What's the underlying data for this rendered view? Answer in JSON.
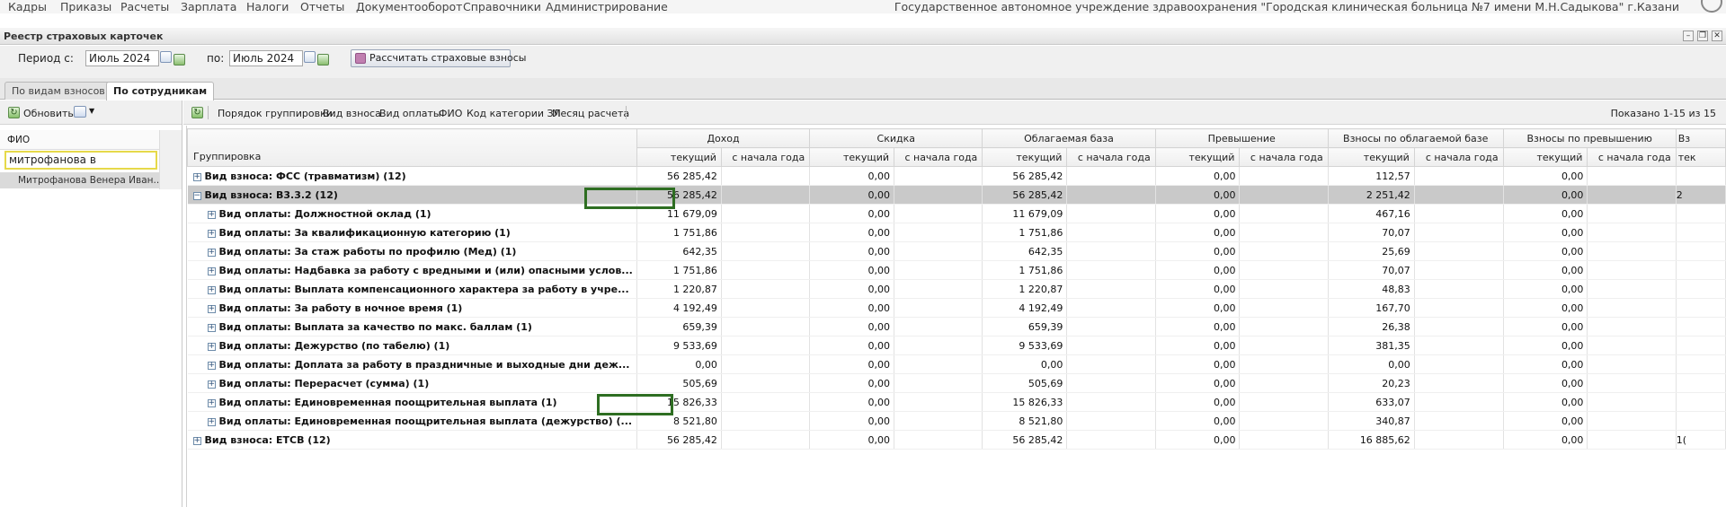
{
  "menu": {
    "items": [
      "Кадры",
      "Приказы",
      "Расчеты",
      "Зарплата",
      "Налоги",
      "Отчеты",
      "Документооборот",
      "Справочники",
      "Администрирование"
    ],
    "organization": "Государственное автономное учреждение здравоохранения \"Городская клиническая больница №7 имени М.Н.Садыкова\" г.Казани"
  },
  "panel": {
    "title": "Реестр страховых карточек",
    "window_buttons": [
      "–",
      "❐",
      "✕"
    ]
  },
  "period": {
    "from_label": "Период с:",
    "from_value": "Июль 2024",
    "to_label": "по:",
    "to_value": "Июль 2024",
    "calc_button": "Рассчитать страховые взносы"
  },
  "tabs": [
    {
      "label": "По видам взносов",
      "active": false
    },
    {
      "label": "По сотрудникам",
      "active": true
    }
  ],
  "left": {
    "refresh": "Обновить",
    "fio_header": "ФИО",
    "search_value": "митрофанова в",
    "result": "Митрофанова Венера Иван..."
  },
  "toolbar": {
    "grouping_label": "Порядок группировки:",
    "grouping_items": [
      "Вид взноса",
      "Вид оплаты",
      "ФИО",
      "Код категории ЗЛ",
      "Месяц расчета"
    ],
    "shown": "Показано 1-15 из 15"
  },
  "grid": {
    "group_header": "Группировка",
    "column_groups": [
      "Доход",
      "Скидка",
      "Облагаемая база",
      "Превышение",
      "Взносы по облагаемой базе",
      "Взносы по превышению",
      "Вз"
    ],
    "sub_current": "текущий",
    "sub_ytd": "с начала года",
    "sub_cut": "тек",
    "rows": [
      {
        "label": "Вид взноса: ФСС (травматизм) (12)",
        "level": 0,
        "values": [
          "56 285,42",
          "",
          "0,00",
          "",
          "56 285,42",
          "",
          "0,00",
          "",
          "112,57",
          "",
          "0,00",
          "",
          ""
        ]
      },
      {
        "label": "Вид взноса: В3.3.2 (12)",
        "level": 0,
        "expanded": true,
        "selected": true,
        "values": [
          "56 285,42",
          "",
          "0,00",
          "",
          "56 285,42",
          "",
          "0,00",
          "",
          "2 251,42",
          "",
          "0,00",
          "",
          "2"
        ]
      },
      {
        "label": "Вид оплаты: Должностной оклад (1)",
        "level": 1,
        "values": [
          "11 679,09",
          "",
          "0,00",
          "",
          "11 679,09",
          "",
          "0,00",
          "",
          "467,16",
          "",
          "0,00",
          "",
          ""
        ]
      },
      {
        "label": "Вид оплаты: За квалификационную категорию (1)",
        "level": 1,
        "values": [
          "1 751,86",
          "",
          "0,00",
          "",
          "1 751,86",
          "",
          "0,00",
          "",
          "70,07",
          "",
          "0,00",
          "",
          ""
        ]
      },
      {
        "label": "Вид оплаты: За стаж работы по профилю (Мед) (1)",
        "level": 1,
        "values": [
          "642,35",
          "",
          "0,00",
          "",
          "642,35",
          "",
          "0,00",
          "",
          "25,69",
          "",
          "0,00",
          "",
          ""
        ]
      },
      {
        "label": "Вид оплаты: Надбавка за работу с вредными и (или) опасными услов...",
        "level": 1,
        "values": [
          "1 751,86",
          "",
          "0,00",
          "",
          "1 751,86",
          "",
          "0,00",
          "",
          "70,07",
          "",
          "0,00",
          "",
          ""
        ]
      },
      {
        "label": "Вид оплаты: Выплата компенсационного характера за работу в учре...",
        "level": 1,
        "values": [
          "1 220,87",
          "",
          "0,00",
          "",
          "1 220,87",
          "",
          "0,00",
          "",
          "48,83",
          "",
          "0,00",
          "",
          ""
        ]
      },
      {
        "label": "Вид оплаты: За работу в ночное время (1)",
        "level": 1,
        "values": [
          "4 192,49",
          "",
          "0,00",
          "",
          "4 192,49",
          "",
          "0,00",
          "",
          "167,70",
          "",
          "0,00",
          "",
          ""
        ]
      },
      {
        "label": "Вид оплаты: Выплата за качество по макс. баллам (1)",
        "level": 1,
        "values": [
          "659,39",
          "",
          "0,00",
          "",
          "659,39",
          "",
          "0,00",
          "",
          "26,38",
          "",
          "0,00",
          "",
          ""
        ]
      },
      {
        "label": "Вид оплаты: Дежурство (по табелю) (1)",
        "level": 1,
        "values": [
          "9 533,69",
          "",
          "0,00",
          "",
          "9 533,69",
          "",
          "0,00",
          "",
          "381,35",
          "",
          "0,00",
          "",
          ""
        ]
      },
      {
        "label": "Вид оплаты: Доплата за работу в праздничные и выходные дни деж...",
        "level": 1,
        "values": [
          "0,00",
          "",
          "0,00",
          "",
          "0,00",
          "",
          "0,00",
          "",
          "0,00",
          "",
          "0,00",
          "",
          ""
        ]
      },
      {
        "label": "Вид оплаты: Перерасчет (сумма) (1)",
        "level": 1,
        "values": [
          "505,69",
          "",
          "0,00",
          "",
          "505,69",
          "",
          "0,00",
          "",
          "20,23",
          "",
          "0,00",
          "",
          ""
        ]
      },
      {
        "label": "Вид оплаты: Единовременная поощрительная выплата (1)",
        "level": 1,
        "values": [
          "15 826,33",
          "",
          "0,00",
          "",
          "15 826,33",
          "",
          "0,00",
          "",
          "633,07",
          "",
          "0,00",
          "",
          ""
        ]
      },
      {
        "label": "Вид оплаты: Единовременная поощрительная выплата (дежурство) (...",
        "level": 1,
        "values": [
          "8 521,80",
          "",
          "0,00",
          "",
          "8 521,80",
          "",
          "0,00",
          "",
          "340,87",
          "",
          "0,00",
          "",
          ""
        ]
      },
      {
        "label": "Вид взноса: ЕТСВ (12)",
        "level": 0,
        "values": [
          "56 285,42",
          "",
          "0,00",
          "",
          "56 285,42",
          "",
          "0,00",
          "",
          "16 885,62",
          "",
          "0,00",
          "",
          "1("
        ]
      }
    ]
  }
}
